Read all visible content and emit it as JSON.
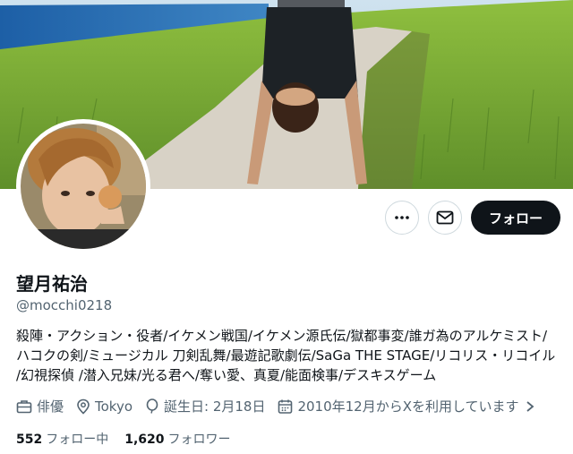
{
  "profile": {
    "display_name": "望月祐治",
    "handle": "@mocchi0218",
    "bio_lines": [
      "殺陣・アクション・役者/イケメン戦国/イケメン源氏伝/獄都事変/誰ガ為のアルケミスト/",
      "ハコクの剣/ミュージカル 刀剣乱舞/最遊記歌劇伝/SaGa THE STAGE/リコリス・リコイル",
      "/幻視探偵 /潜入兄妹/光る君へ/奪い愛、真夏/能面検事/デスキスゲーム"
    ]
  },
  "actions": {
    "more_icon": "ellipsis-icon",
    "message_icon": "mail-icon",
    "follow_label": "フォロー"
  },
  "meta": {
    "occupation": "俳優",
    "location": "Tokyo",
    "birthday": "誕生日: 2月18日",
    "joined": "2010年12月からXを利用しています"
  },
  "stats": {
    "following_count": "552",
    "following_label": "フォロー中",
    "followers_count": "1,620",
    "followers_label": "フォロワー"
  },
  "colors": {
    "text_primary": "#0f1419",
    "text_secondary": "#536471",
    "button_bg": "#0f1419",
    "border": "#cfd9de"
  }
}
